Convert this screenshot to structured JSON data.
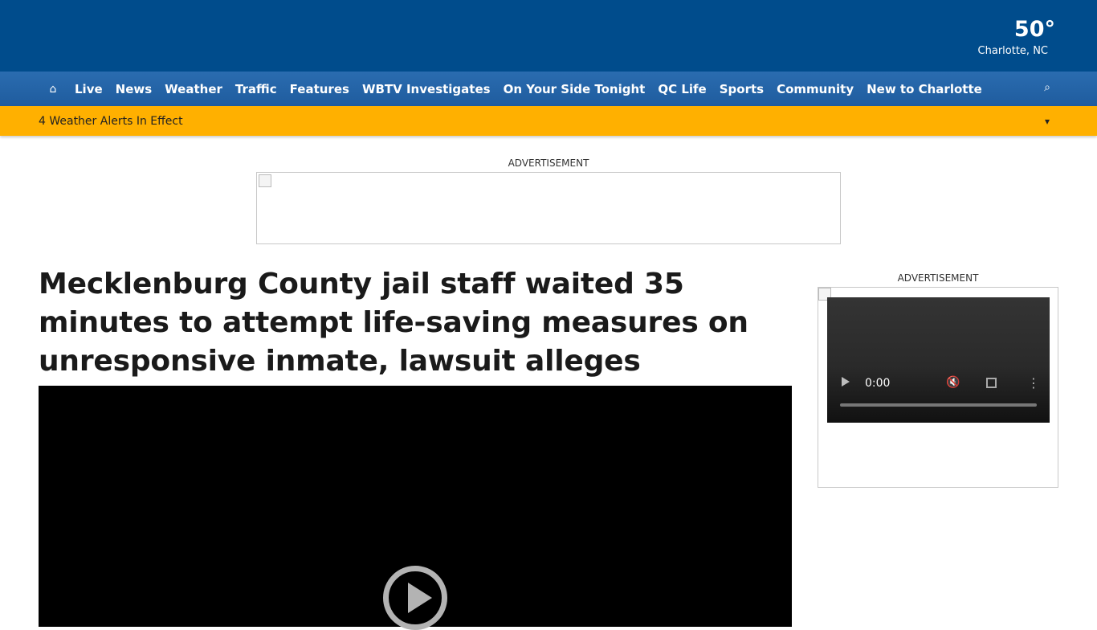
{
  "weather": {
    "temperature": "50°",
    "location": "Charlotte, NC"
  },
  "nav": {
    "home_icon": "home-icon",
    "items": [
      "Live",
      "News",
      "Weather",
      "Traffic",
      "Features",
      "WBTV Investigates",
      "On Your Side Tonight",
      "QC Life",
      "Sports",
      "Community",
      "New to Charlotte"
    ],
    "search_icon": "search-icon"
  },
  "alert": {
    "text": "4 Weather Alerts In Effect",
    "toggle_icon": "chevron-down-icon"
  },
  "ads": {
    "top_label": "ADVERTISEMENT",
    "side_label": "ADVERTISEMENT"
  },
  "article": {
    "headline": "Mecklenburg County jail staff waited 35 minutes to attempt life-saving measures on unresponsive inmate, lawsuit alleges"
  },
  "side_video": {
    "time": "0:00"
  },
  "colors": {
    "header": "#004c8c",
    "nav": "#1f5c9e",
    "alert": "#ffb000"
  }
}
